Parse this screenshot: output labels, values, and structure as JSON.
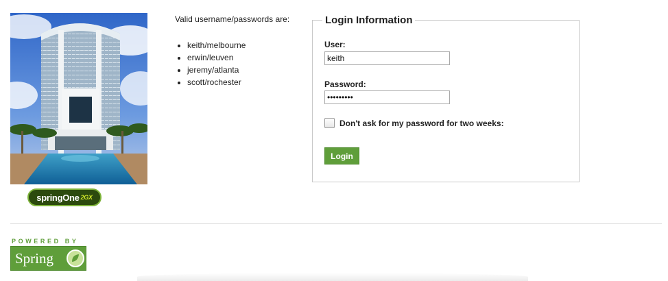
{
  "header_image": {
    "alt": "Hotel tower with pool"
  },
  "springone_logo": {
    "text": "springOne",
    "suffix": "2GX"
  },
  "valid_users": {
    "title": "Valid username/passwords are:",
    "items": [
      "keith/melbourne",
      "erwin/leuven",
      "jeremy/atlanta",
      "scott/rochester"
    ]
  },
  "login": {
    "legend": "Login Information",
    "user_label": "User:",
    "user_value": "keith",
    "password_label": "Password:",
    "password_value": "melbourne",
    "remember_label": "Don't ask for my password for two weeks:",
    "remember_checked": false,
    "button_label": "Login"
  },
  "footer": {
    "powered_by": "POWERED BY",
    "spring_logo_text": "Spring"
  },
  "colors": {
    "accent_green": "#5f9e3a",
    "border": "#c8c8c8"
  }
}
